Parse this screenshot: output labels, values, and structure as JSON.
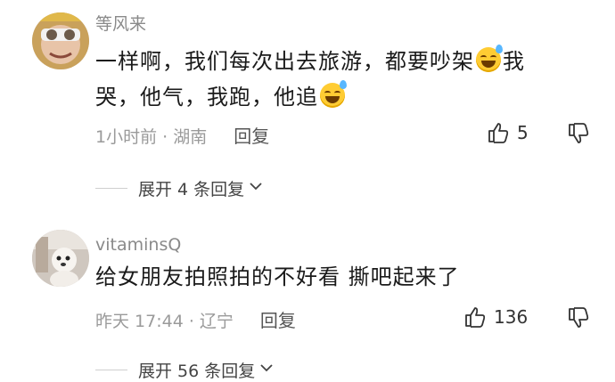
{
  "comments": [
    {
      "username": "等风来",
      "line1": "一样啊，我们每次出去旅游，都要吵架",
      "line1_end": "我",
      "line2": "哭，他气，我跑，他追",
      "meta": "1小时前 · 湖南",
      "reply_label": "回复",
      "likes": "5",
      "expand_label": "展开 4 条回复"
    },
    {
      "username": "vitaminsQ",
      "line1": "给女朋友拍照拍的不好看 撕吧起来了",
      "meta": "昨天 17:44 · 辽宁",
      "reply_label": "回复",
      "likes": "136",
      "expand_label": "展开 56 条回复"
    }
  ],
  "icons": {
    "emoji": "grinning-sweat-emoji",
    "like": "thumbs-up-icon",
    "dislike": "thumbs-down-icon",
    "expand": "chevron-down-icon"
  },
  "colors": {
    "meta_gray": "#9a9a9a",
    "text": "#1a1a1a",
    "emoji_yellow": "#ffcc33"
  }
}
